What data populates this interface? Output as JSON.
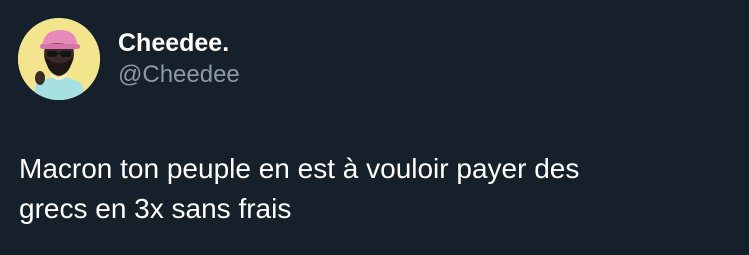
{
  "author": {
    "display_name": "Cheedee.",
    "handle": "@Cheedee",
    "avatar_icon": "user-avatar-illustration"
  },
  "tweet": {
    "line1": "Macron ton peuple en est à vouloir payer des",
    "line2": "grecs en 3x sans frais"
  },
  "colors": {
    "background": "#15202b",
    "primary_text": "#ffffff",
    "secondary_text": "#8b98a5",
    "avatar_bg": "#f2e58d"
  }
}
